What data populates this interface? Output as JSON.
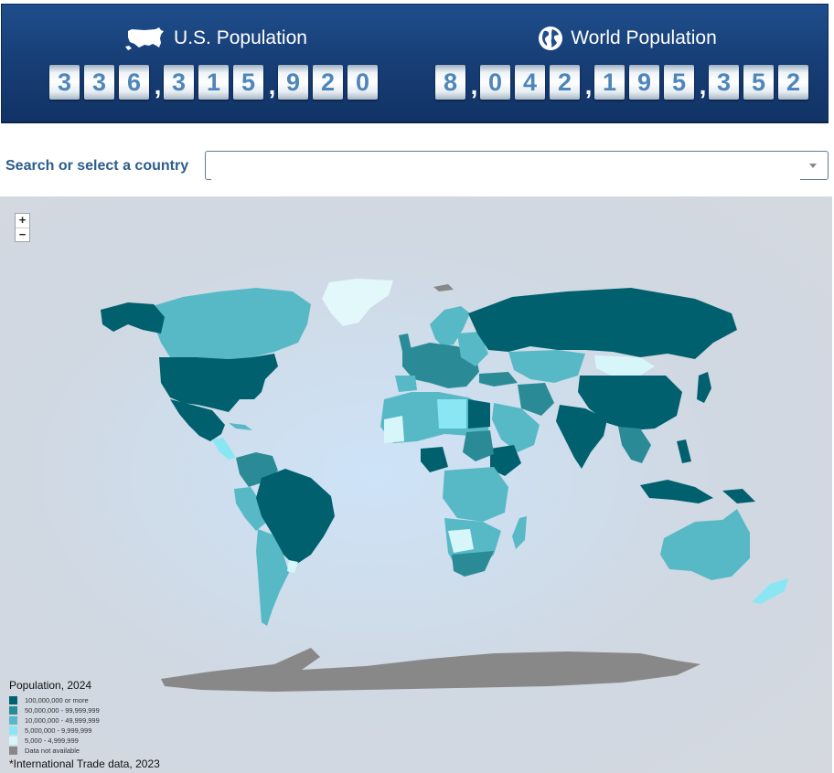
{
  "header": {
    "us": {
      "title": "U.S. Population",
      "icon": "us-map-icon",
      "digits": [
        "3",
        "3",
        "6",
        ",",
        "3",
        "1",
        "5",
        ",",
        "9",
        "2",
        "0"
      ]
    },
    "world": {
      "title": "World Population",
      "icon": "globe-icon",
      "digits": [
        "8",
        ",",
        "0",
        "4",
        "2",
        ",",
        "1",
        "9",
        "5",
        ",",
        "3",
        "5",
        "2"
      ]
    }
  },
  "search": {
    "label": "Search or select a country",
    "value": "",
    "placeholder": ""
  },
  "map": {
    "zoom_in": "+",
    "zoom_out": "−",
    "legend": {
      "title": "Population, 2024",
      "items": [
        {
          "label": "100,000,000 or more",
          "color": "#00606e"
        },
        {
          "label": "50,000,000 - 99,999,999",
          "color": "#2a8b97"
        },
        {
          "label": "10,000,000 - 49,999,999",
          "color": "#58b9c6"
        },
        {
          "label": "5,000,000 - 9,999,999",
          "color": "#8ae6f3"
        },
        {
          "label": "5,000 - 4,999,999",
          "color": "#d6f6fa"
        },
        {
          "label": "Data not available",
          "color": "#888888"
        }
      ]
    },
    "footnote": "*International Trade data, 2023"
  },
  "colors": {
    "banner": "#173f77",
    "digit_text": "#4f86b9",
    "label": "#2b5d8e",
    "ocean": "#cde3f7"
  }
}
